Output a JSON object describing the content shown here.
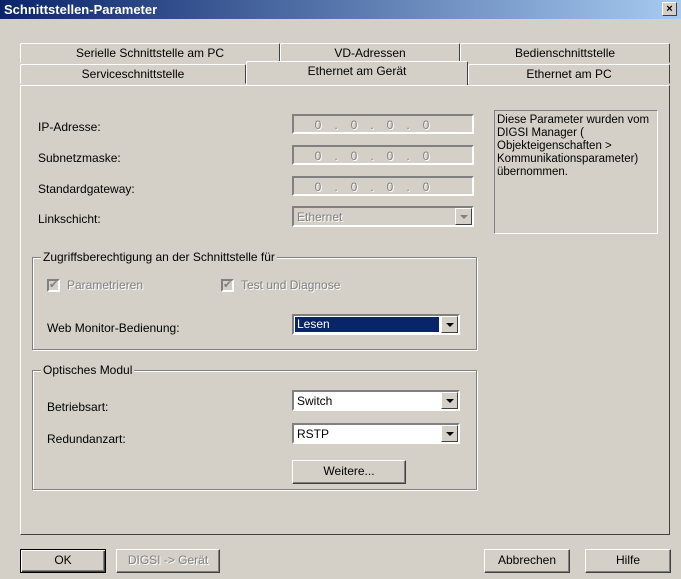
{
  "window": {
    "title": "Schnittstellen-Parameter",
    "close_label": "×"
  },
  "tabs": {
    "row1": [
      "Serielle Schnittstelle am PC",
      "VD-Adressen",
      "Bedienschnittstelle"
    ],
    "row2": [
      "Serviceschnittstelle",
      "Ethernet am Gerät",
      "Ethernet am PC"
    ],
    "active": "Ethernet am Gerät"
  },
  "network": {
    "ip_label": "IP-Adresse:",
    "subnet_label": "Subnetzmaske:",
    "gateway_label": "Standardgateway:",
    "link_label": "Linkschicht:",
    "ip_value": [
      "0",
      "0",
      "0",
      "0"
    ],
    "subnet_value": [
      "0",
      "0",
      "0",
      "0"
    ],
    "gateway_value": [
      "0",
      "0",
      "0",
      "0"
    ],
    "link_value": "Ethernet",
    "info_text": "Diese Parameter wurden vom DIGSI Manager ( Objekteigenschaften > Kommunikationsparameter) übernommen."
  },
  "access": {
    "legend": "Zugriffsberechtigung an der Schnittstelle für",
    "param_label": "Parametrieren",
    "test_label": "Test und Diagnose",
    "web_label": "Web Monitor-Bedienung:",
    "web_value": "Lesen"
  },
  "optical": {
    "legend": "Optisches Modul",
    "mode_label": "Betriebsart:",
    "mode_value": "Switch",
    "redundancy_label": "Redundanzart:",
    "redundancy_value": "RSTP",
    "more_button": "Weitere..."
  },
  "footer": {
    "ok": "OK",
    "digsi": "DIGSI -> Gerät",
    "cancel": "Abbrechen",
    "help": "Hilfe"
  }
}
